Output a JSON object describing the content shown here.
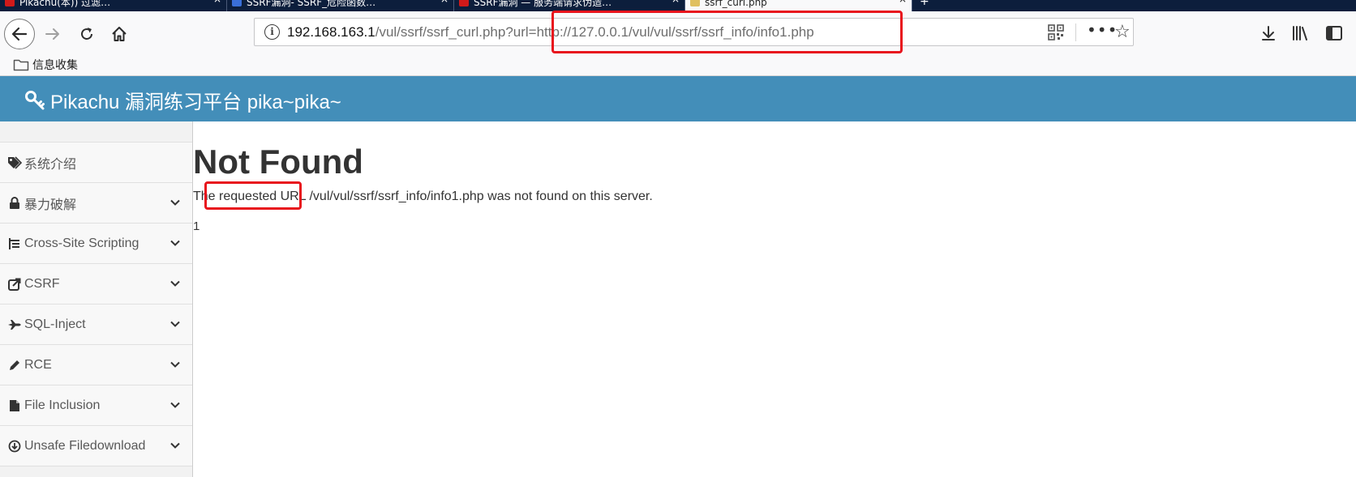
{
  "browser": {
    "tabs": [
      {
        "label": "Pikachu(本)) 过滤…",
        "favicon_color": "#d11a1a"
      },
      {
        "label": "SSRF漏洞- SSRF_危险函数…",
        "favicon_color": "#3a6fd8"
      },
      {
        "label": "SSRF漏洞 — 服务端请求伪造…",
        "favicon_color": "#d11a1a"
      },
      {
        "label": "ssrf_curl.php",
        "favicon_color": "#e0c060",
        "active": true
      }
    ],
    "url": {
      "host": "192.168.163.1",
      "path": "/vul/ssrf/ssrf_curl.php?url=http://127.0.0.1/vul/vul/ssrf/ssrf_info/info1.php"
    },
    "bookmark": {
      "label": "信息收集",
      "icon": "folder-icon"
    }
  },
  "app": {
    "title": "Pikachu 漏洞练习平台 pika~pika~",
    "brand_color": "#438eb9"
  },
  "sidebar": {
    "items": [
      {
        "label": "系统介绍",
        "icon": "tags-icon",
        "has_chevron": false
      },
      {
        "label": "暴力破解",
        "icon": "lock-icon",
        "has_chevron": true
      },
      {
        "label": "Cross-Site Scripting",
        "icon": "list-icon",
        "has_chevron": true
      },
      {
        "label": "CSRF",
        "icon": "share-icon",
        "has_chevron": true
      },
      {
        "label": "SQL-Inject",
        "icon": "fighter-jet-icon",
        "has_chevron": true
      },
      {
        "label": "RCE",
        "icon": "pencil-icon",
        "has_chevron": true
      },
      {
        "label": "File Inclusion",
        "icon": "file-icon",
        "has_chevron": true
      },
      {
        "label": "Unsafe Filedownload",
        "icon": "download-icon",
        "has_chevron": true
      }
    ]
  },
  "main": {
    "heading": "Not Found",
    "message": "The requested URL /vul/vul/ssrf/ssrf_info/info1.php was not found on this server.",
    "number": "1"
  },
  "annotation_color": "#e8141d"
}
